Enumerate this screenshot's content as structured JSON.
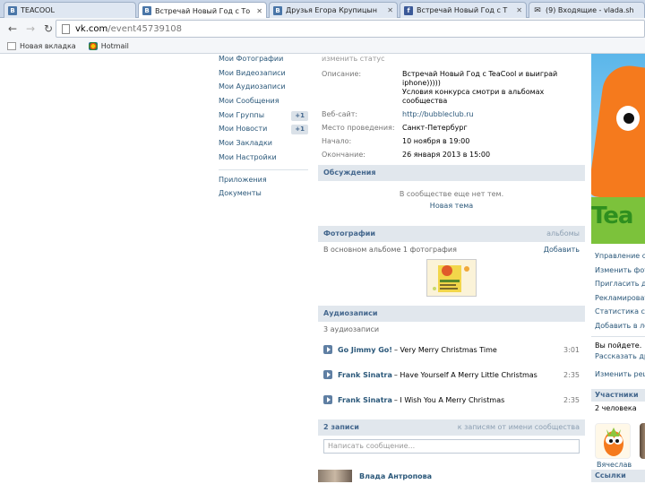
{
  "browser": {
    "tabs": [
      {
        "title": "TEACOOL",
        "favicon": "vk-icon",
        "active": false
      },
      {
        "title": "Встречай Новый Год с То",
        "favicon": "vk-icon",
        "active": true
      },
      {
        "title": "Друзья Егора Крупицын",
        "favicon": "vk-icon",
        "active": false
      },
      {
        "title": "Встречай Новый Год с Т",
        "favicon": "facebook-icon",
        "active": false
      },
      {
        "title": "(9) Входящие - vlada.sh",
        "favicon": "mail-icon",
        "active": false
      }
    ],
    "url_host": "vk.com",
    "url_path": "/event45739108",
    "bookmarks": [
      {
        "label": "Новая вкладка",
        "icon": "page-icon"
      },
      {
        "label": "Hotmail",
        "icon": "ie-icon"
      }
    ]
  },
  "left_menu": {
    "items": [
      {
        "label": "Мои Фотографии",
        "count": ""
      },
      {
        "label": "Мои Видеозаписи",
        "count": ""
      },
      {
        "label": "Мои Аудиозаписи",
        "count": ""
      },
      {
        "label": "Мои Сообщения",
        "count": ""
      },
      {
        "label": "Мои Группы",
        "count": "+1"
      },
      {
        "label": "Мои Новости",
        "count": "+1"
      },
      {
        "label": "Мои Закладки",
        "count": ""
      },
      {
        "label": "Мои Настройки",
        "count": ""
      }
    ],
    "extra": [
      {
        "label": "Приложения"
      },
      {
        "label": "Документы"
      }
    ]
  },
  "event": {
    "status_placeholder": "изменить статус",
    "info": [
      {
        "label": "Описание:",
        "value": "Встречай Новый Год с TeaCool и выиграй iphone)))))\nУсловия конкурса смотри в альбомах сообщества",
        "link": false
      },
      {
        "label": "Веб-сайт:",
        "value": "http://bubbleclub.ru",
        "link": true
      },
      {
        "label": "Место проведения:",
        "value": "Санкт-Петербург",
        "link": false
      },
      {
        "label": "Начало:",
        "value": "10 ноября в 19:00",
        "link": false
      },
      {
        "label": "Окончание:",
        "value": "26 января 2013 в 15:00",
        "link": false
      }
    ]
  },
  "discussions": {
    "title": "Обсуждения",
    "empty_text": "В сообществе еще нет тем.",
    "new_topic": "Новая тема"
  },
  "photos": {
    "title": "Фотографии",
    "right_link": "альбомы",
    "subtitle": "В основном альбоме 1 фотография",
    "add_link": "Добавить"
  },
  "audio": {
    "title": "Аудиозаписи",
    "count_text": "3 аудиозаписи",
    "tracks": [
      {
        "artist": "Go Jimmy Go!",
        "song": "– Very Merry Christmas Time",
        "duration": "3:01"
      },
      {
        "artist": "Frank Sinatra",
        "song": "– Have Yourself A Merry Little Christmas",
        "duration": "2:35"
      },
      {
        "artist": "Frank Sinatra",
        "song": "– I Wish You A Merry Christmas",
        "duration": "2:35"
      }
    ]
  },
  "wall": {
    "title": "2 записи",
    "right_link": "к записям от имени сообщества",
    "input_placeholder": "Написать сообщение...",
    "first_author": "Влада Антропова"
  },
  "right_column": {
    "mascot_text": "Tea",
    "admin_links": [
      "Управление сообществом",
      "Изменить фотографию",
      "Пригласить друзей",
      "Рекламировать",
      "Статистика сообщества",
      "Добавить в левое меню"
    ],
    "going_text": "Вы пойдете.",
    "tell_friends": "Рассказать друзьям",
    "change_decision": "Изменить решение",
    "members_title": "Участники",
    "members_count": "2 человека",
    "member_name": "Вячеслав",
    "links_title": "Ссылки"
  }
}
